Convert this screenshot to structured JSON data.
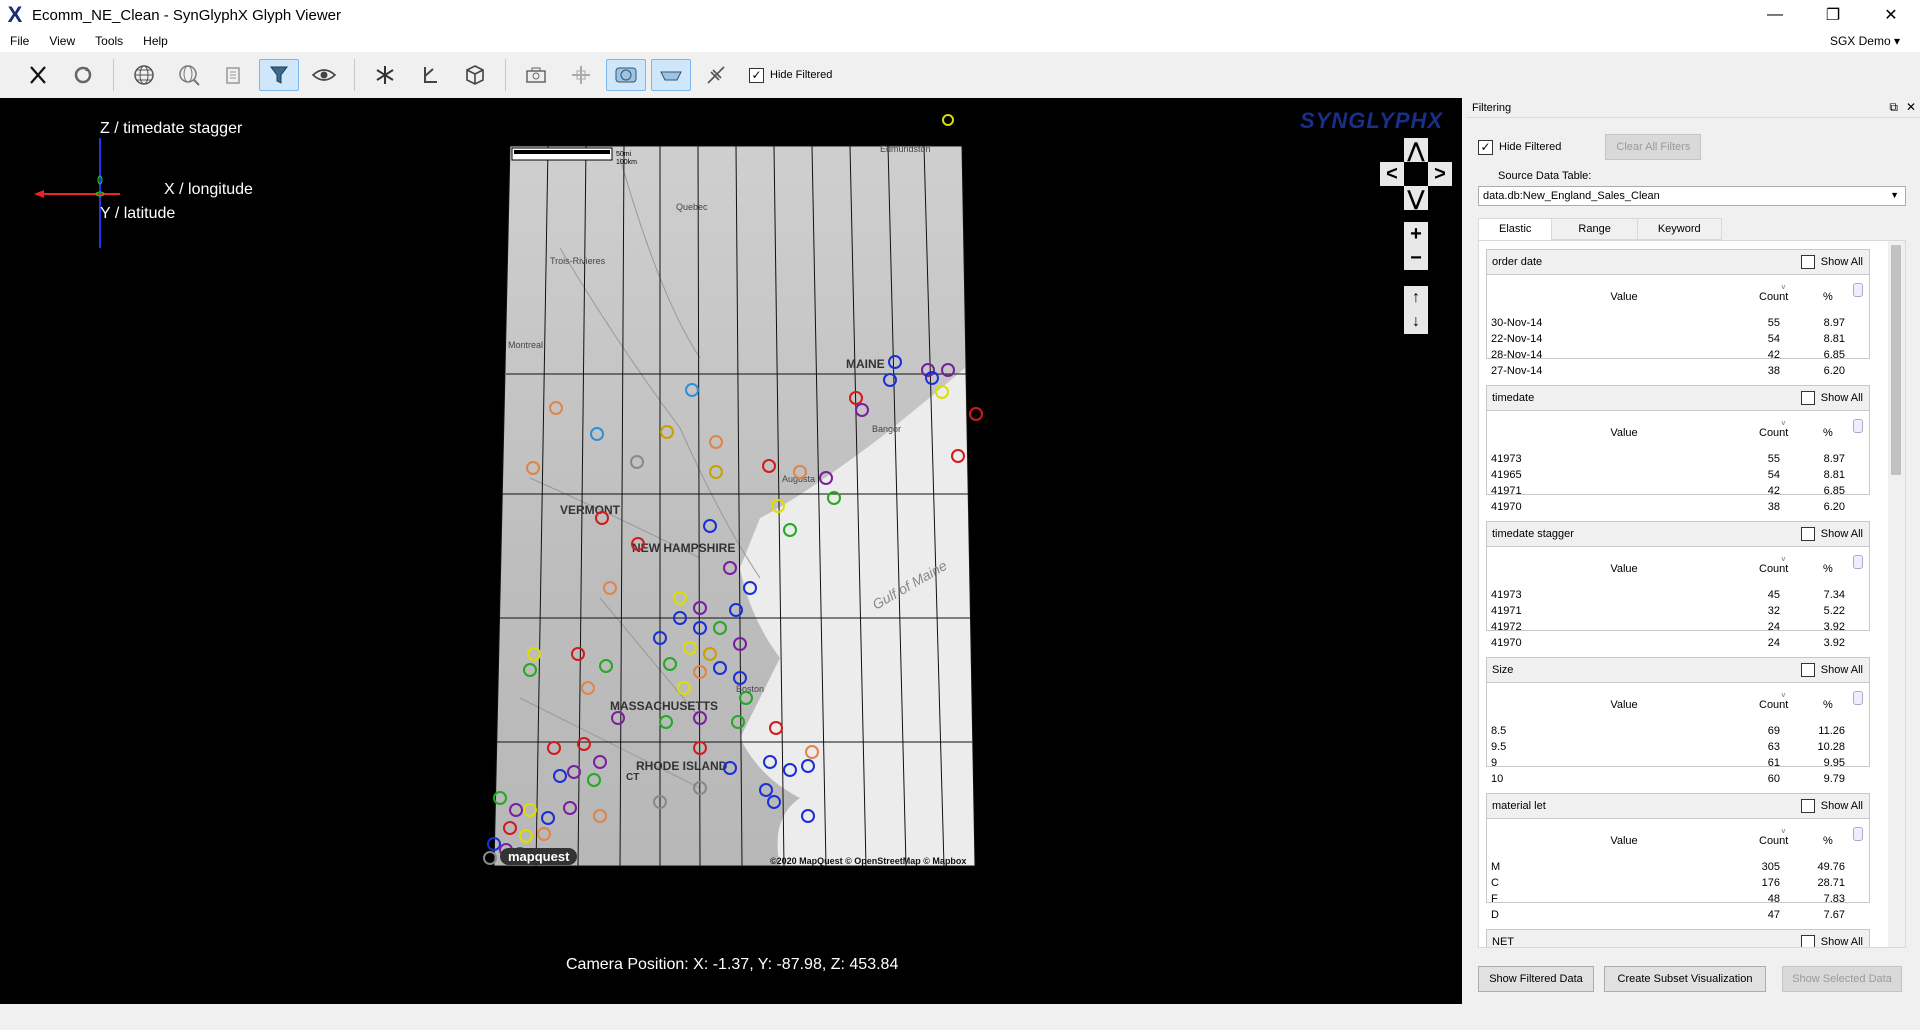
{
  "window": {
    "app_icon": "X",
    "title": "Ecomm_NE_Clean - SynGlyphX Glyph Viewer",
    "minimize": "—",
    "restore": "❐",
    "close": "✕"
  },
  "menu": {
    "items": [
      "File",
      "View",
      "Tools",
      "Help"
    ],
    "user": "SGX Demo ▾"
  },
  "toolbar": {
    "hide_filtered_label": "Hide Filtered",
    "hide_filtered_checked": "✓"
  },
  "viewport": {
    "axis_z": "Z / timedate stagger",
    "axis_x": "X / longitude",
    "axis_y": "Y / latitude",
    "logo": "SYNGLYPHX",
    "camera": "Camera Position: X: -1.37, Y: -87.98, Z: 453.84",
    "map_labels": [
      "MAINE",
      "VERMONT",
      "NEW HAMPSHIRE",
      "MASSACHUSETTS",
      "RHODE ISLAND",
      "CT",
      "Gulf of Maine",
      "Bangor",
      "Augusta",
      "Boston",
      "Quebec",
      "Montreal",
      "Trois-Rivieres",
      "Edmundston"
    ],
    "scale_labels": [
      "50mi",
      "100km"
    ],
    "attribution": "©2020 MapQuest © OpenStreetMap © Mapbox",
    "mapquest": "mapquest",
    "nav": {
      "up": "⋀",
      "left": "<",
      "right": ">",
      "down": "⋁",
      "zoom_in": "+",
      "zoom_out": "−",
      "move_up": "↑",
      "move_down": "↓"
    }
  },
  "panel": {
    "title": "Filtering",
    "hide_filtered_label": "Hide Filtered",
    "hide_filtered_checked": "✓",
    "clear_all": "Clear All Filters",
    "source_label": "Source Data Table:",
    "source_value": "data.db:New_England_Sales_Clean",
    "tabs": [
      "Elastic",
      "Range",
      "Keyword"
    ],
    "show_all": "Show All",
    "col_value": "Value",
    "col_count": "Count",
    "col_pct": "%",
    "filters": [
      {
        "name": "order date",
        "rows": [
          {
            "value": "30-Nov-14",
            "count": "55",
            "pct": "8.97"
          },
          {
            "value": "22-Nov-14",
            "count": "54",
            "pct": "8.81"
          },
          {
            "value": "28-Nov-14",
            "count": "42",
            "pct": "6.85"
          },
          {
            "value": "27-Nov-14",
            "count": "38",
            "pct": "6.20"
          }
        ]
      },
      {
        "name": "timedate",
        "rows": [
          {
            "value": "41973",
            "count": "55",
            "pct": "8.97"
          },
          {
            "value": "41965",
            "count": "54",
            "pct": "8.81"
          },
          {
            "value": "41971",
            "count": "42",
            "pct": "6.85"
          },
          {
            "value": "41970",
            "count": "38",
            "pct": "6.20"
          }
        ]
      },
      {
        "name": "timedate stagger",
        "rows": [
          {
            "value": "41973",
            "count": "45",
            "pct": "7.34"
          },
          {
            "value": "41971",
            "count": "32",
            "pct": "5.22"
          },
          {
            "value": "41972",
            "count": "24",
            "pct": "3.92"
          },
          {
            "value": "41970",
            "count": "24",
            "pct": "3.92"
          }
        ]
      },
      {
        "name": "Size",
        "rows": [
          {
            "value": "8.5",
            "count": "69",
            "pct": "11.26"
          },
          {
            "value": "9.5",
            "count": "63",
            "pct": "10.28"
          },
          {
            "value": "9",
            "count": "61",
            "pct": "9.95"
          },
          {
            "value": "10",
            "count": "60",
            "pct": "9.79"
          }
        ]
      },
      {
        "name": "material let",
        "rows": [
          {
            "value": "M",
            "count": "305",
            "pct": "49.76"
          },
          {
            "value": "C",
            "count": "176",
            "pct": "28.71"
          },
          {
            "value": "F",
            "count": "48",
            "pct": "7.83"
          },
          {
            "value": "D",
            "count": "47",
            "pct": "7.67"
          }
        ]
      },
      {
        "name": "NET",
        "rows": []
      }
    ],
    "show_filtered": "Show Filtered Data",
    "create_subset": "Create Subset Visualization",
    "show_selected": "Show Selected Data"
  }
}
